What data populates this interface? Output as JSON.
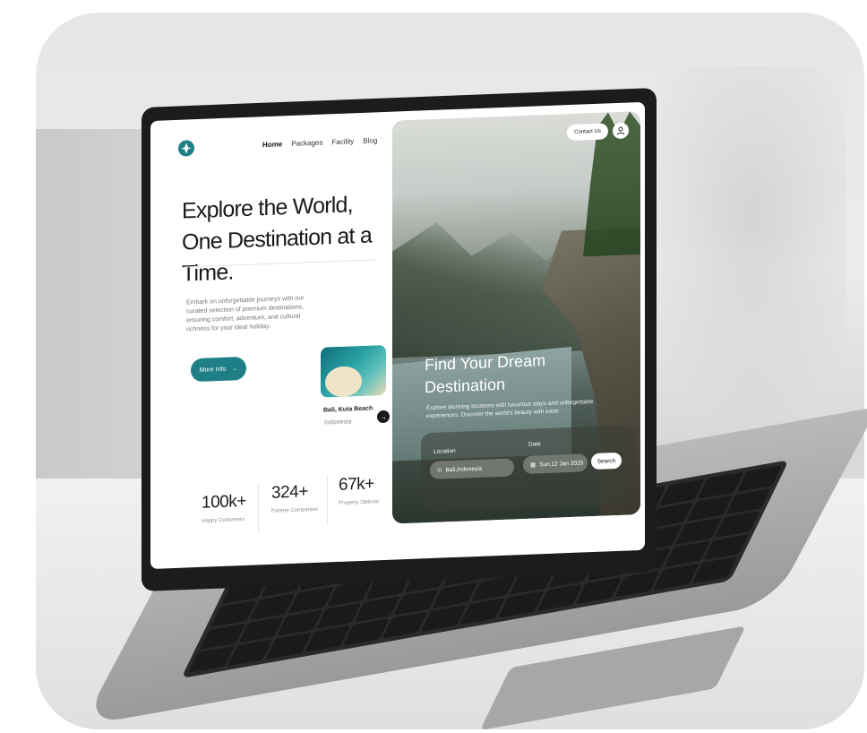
{
  "nav": {
    "items": [
      "Home",
      "Packages",
      "Facility",
      "Blog"
    ],
    "active": "Home"
  },
  "hero_left": {
    "headline": "Explore the World, One Destination at a Time.",
    "description": "Embark on unforgettable journeys with our curated selection of premium destinations, ensuring comfort, adventure, and cultural richness for your ideal holiday.",
    "cta_label": "More Info"
  },
  "featured": {
    "title": "Bali, Kuta Beach",
    "subtitle": "Indonesia"
  },
  "stats": [
    {
      "value": "100k+",
      "label": "Happy Customers"
    },
    {
      "value": "324+",
      "label": "Partner Companies"
    },
    {
      "value": "67k+",
      "label": "Property Options"
    }
  ],
  "header_right": {
    "contact_label": "Contact Us"
  },
  "hero_right": {
    "title": "Find Your Dream Destination",
    "description": "Explore stunning locations with luxurious stays and unforgettable experiences. Discover the world's beauty with ease."
  },
  "search": {
    "location_label": "Location",
    "location_value": "Bali,Indonesia",
    "date_label": "Date",
    "date_value": "Sun,12 Jan 2025",
    "search_label": "Search"
  },
  "colors": {
    "accent": "#1f7f86"
  },
  "icons": [
    "star-logo-icon",
    "arrow-right-icon",
    "user-icon",
    "map-pin-icon",
    "calendar-icon"
  ]
}
